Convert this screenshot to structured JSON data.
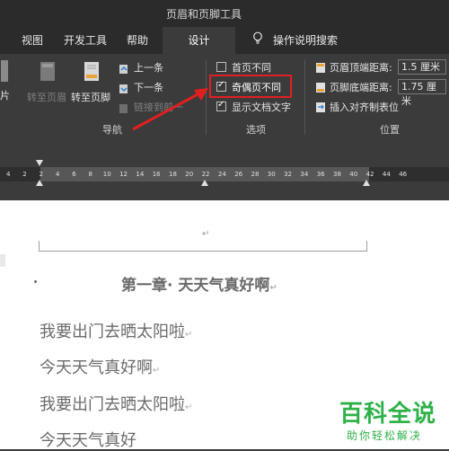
{
  "app": {
    "context_title": "页眉和页脚工具"
  },
  "tabs": [
    {
      "label": "视图"
    },
    {
      "label": "开发工具"
    },
    {
      "label": "帮助"
    },
    {
      "label": "设计"
    },
    {
      "label": "操作说明搜索"
    }
  ],
  "ribbon": {
    "nav": {
      "partial_left": "片",
      "go_to_header": "转至页眉",
      "go_to_footer": "转至页脚",
      "previous": "上一条",
      "next": "下一条",
      "link_to_previous": "链接到前一",
      "group_label": "导航"
    },
    "options": {
      "first_page_different": "首页不同",
      "odd_even_different": "奇偶页不同",
      "show_document_text": "显示文档文字",
      "group_label": "选项",
      "checked": {
        "first_page_different": false,
        "odd_even_different": true,
        "show_document_text": true
      }
    },
    "position": {
      "header_from_top_label": "页眉顶端距离:",
      "header_from_top_value": "1.5 厘米",
      "footer_from_bottom_label": "页脚底端距离:",
      "footer_from_bottom_value": "1.75 厘米",
      "insert_alignment_tab": "插入对齐制表位",
      "group_label": "位置"
    }
  },
  "ruler": {
    "ticks": [
      "4",
      "2",
      "2",
      "4",
      "6",
      "8",
      "10",
      "12",
      "14",
      "16",
      "18",
      "20",
      "22",
      "24",
      "26",
      "28",
      "30",
      "32",
      "34",
      "36",
      "38",
      "40",
      "42",
      "44",
      "46"
    ]
  },
  "document": {
    "heading": "第一章· 天天气真好啊",
    "lines": [
      "我要出门去晒太阳啦",
      "今天天气真好啊",
      "我要出门去晒太阳啦",
      "今天天气真好"
    ]
  },
  "watermark": {
    "title": "百科全说",
    "subtitle": "助你轻松解决"
  },
  "colors": {
    "highlight_box": "#e02020",
    "arrow": "#e02020",
    "watermark": "#2fb14a"
  }
}
